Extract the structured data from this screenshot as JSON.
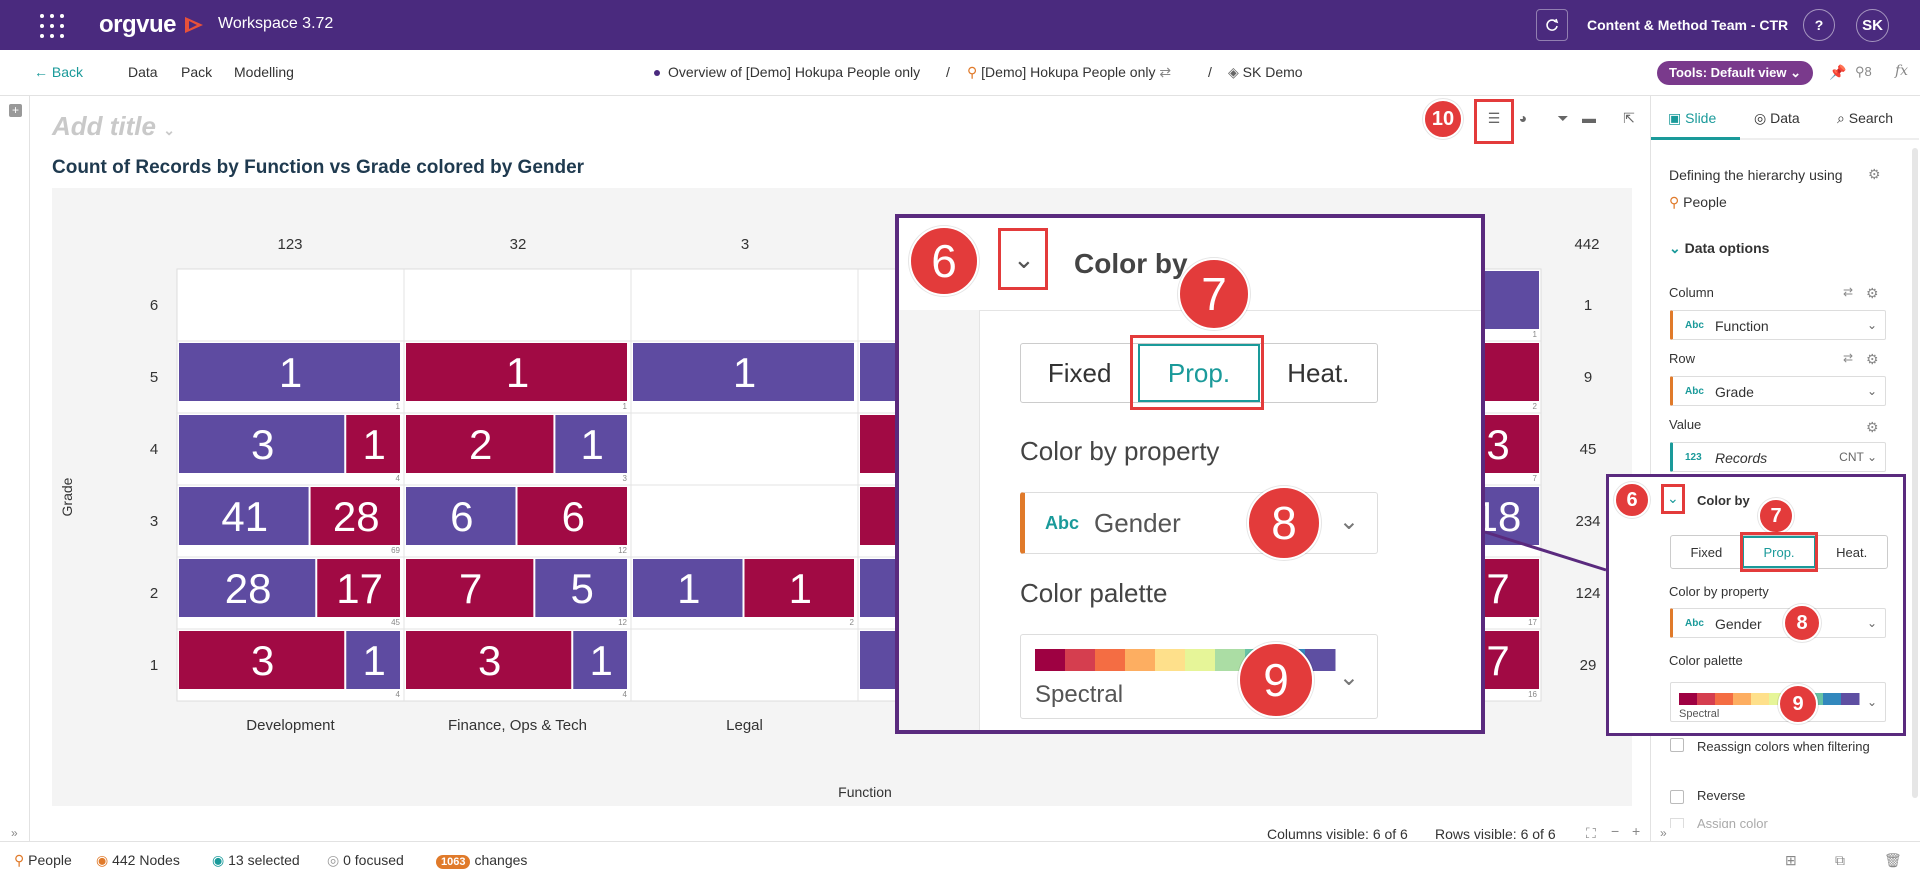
{
  "app": {
    "logo": "orgvue",
    "workspace": "Workspace  3.72",
    "team": "Content & Method Team - CTR",
    "help": "?",
    "avatar": "SK"
  },
  "subnav": {
    "back": "Back",
    "items": [
      "Data",
      "Pack",
      "Modelling"
    ],
    "crumb1": "Overview of [Demo] Hokupa People only",
    "crumb2": "[Demo] Hokupa People only",
    "crumb3": "SK Demo",
    "sep": "/",
    "tools": "Tools: Default view",
    "count": "8"
  },
  "canvas": {
    "add_title": "Add title",
    "chart_title": "Count of Records by Function vs Grade colored by Gender"
  },
  "chart_data": {
    "type": "heatmap",
    "title": "Count of Records by Function vs Grade colored by Gender",
    "xlabel": "Function",
    "ylabel": "Grade",
    "column_totals": [
      "123",
      "32",
      "3",
      "442"
    ],
    "row_labels": [
      "6",
      "5",
      "4",
      "3",
      "2",
      "1"
    ],
    "row_totals": [
      "1",
      "9",
      "45",
      "234",
      "124",
      "29"
    ],
    "column_labels": [
      "Development",
      "Finance, Ops & Tech",
      "Legal"
    ],
    "colors": {
      "purple": "#5e4ba1",
      "crimson": "#a10a44"
    },
    "cells": [
      {
        "col": 0,
        "row": 1,
        "parts": [
          {
            "v": "1",
            "c": "purple",
            "w": 1
          }
        ],
        "corner": "1"
      },
      {
        "col": 1,
        "row": 1,
        "parts": [
          {
            "v": "1",
            "c": "crimson",
            "w": 1
          }
        ],
        "corner": "1"
      },
      {
        "col": 2,
        "row": 1,
        "parts": [
          {
            "v": "1",
            "c": "purple",
            "w": 1
          }
        ],
        "corner": ""
      },
      {
        "col": 0,
        "row": 2,
        "parts": [
          {
            "v": "3",
            "c": "purple",
            "w": 0.75
          },
          {
            "v": "1",
            "c": "crimson",
            "w": 0.25
          }
        ],
        "corner": "4"
      },
      {
        "col": 1,
        "row": 2,
        "parts": [
          {
            "v": "2",
            "c": "crimson",
            "w": 0.67
          },
          {
            "v": "1",
            "c": "purple",
            "w": 0.33
          }
        ],
        "corner": "3"
      },
      {
        "col": 0,
        "row": 3,
        "parts": [
          {
            "v": "41",
            "c": "purple",
            "w": 0.59
          },
          {
            "v": "28",
            "c": "crimson",
            "w": 0.41
          }
        ],
        "corner": "69"
      },
      {
        "col": 1,
        "row": 3,
        "parts": [
          {
            "v": "6",
            "c": "purple",
            "w": 0.5
          },
          {
            "v": "6",
            "c": "crimson",
            "w": 0.5
          }
        ],
        "corner": "12"
      },
      {
        "col": 0,
        "row": 4,
        "parts": [
          {
            "v": "28",
            "c": "purple",
            "w": 0.62
          },
          {
            "v": "17",
            "c": "crimson",
            "w": 0.38
          }
        ],
        "corner": "45"
      },
      {
        "col": 1,
        "row": 4,
        "parts": [
          {
            "v": "7",
            "c": "crimson",
            "w": 0.58
          },
          {
            "v": "5",
            "c": "purple",
            "w": 0.42
          }
        ],
        "corner": "12"
      },
      {
        "col": 2,
        "row": 4,
        "parts": [
          {
            "v": "1",
            "c": "purple",
            "w": 0.5
          },
          {
            "v": "1",
            "c": "crimson",
            "w": 0.5
          }
        ],
        "corner": "2"
      },
      {
        "col": 0,
        "row": 5,
        "parts": [
          {
            "v": "3",
            "c": "crimson",
            "w": 0.75
          },
          {
            "v": "1",
            "c": "purple",
            "w": 0.25
          }
        ],
        "corner": "4"
      },
      {
        "col": 1,
        "row": 5,
        "parts": [
          {
            "v": "3",
            "c": "crimson",
            "w": 0.75
          },
          {
            "v": "1",
            "c": "purple",
            "w": 0.25
          }
        ],
        "corner": "4"
      }
    ],
    "partial_right_cells": [
      {
        "row": 0,
        "v": "",
        "c": "purple",
        "corner": "1"
      },
      {
        "row": 1,
        "v": "",
        "c": "crimson",
        "corner": "2"
      },
      {
        "row": 2,
        "v": "3",
        "c": "crimson",
        "corner": "7"
      },
      {
        "row": 3,
        "v": "18",
        "c": "purple",
        "corner": ""
      },
      {
        "row": 4,
        "v": "7",
        "c": "crimson",
        "corner": "17"
      },
      {
        "row": 5,
        "v": "7",
        "c": "crimson",
        "corner": "16"
      }
    ],
    "partial_left_cells": [
      1,
      2,
      3,
      4,
      5
    ]
  },
  "toolbar": {
    "badge": "10"
  },
  "panel": {
    "tabs": [
      "Slide",
      "Data",
      "Search"
    ],
    "hierarchy_text": "Defining the hierarchy using",
    "hierarchy_value": "People",
    "data_options": "Data options",
    "column_label": "Column",
    "column_value": "Function",
    "row_label": "Row",
    "row_value": "Grade",
    "value_label": "Value",
    "value_value": "Records",
    "value_agg": "CNT",
    "abc": "Abc",
    "num": "123",
    "color_by": "Color by",
    "color_modes": [
      "Fixed",
      "Prop.",
      "Heat."
    ],
    "color_by_property": "Color by property",
    "property_value": "Gender",
    "color_palette": "Color palette",
    "palette_value": "Spectral",
    "reassign": "Reassign colors when filtering",
    "reverse": "Reverse",
    "assign": "Assign color"
  },
  "palette_colors": [
    "#9e0142",
    "#d53e4f",
    "#f46d43",
    "#fdae61",
    "#fee08b",
    "#e6f598",
    "#abdda4",
    "#66c2a5",
    "#3288bd",
    "#5e4fa2"
  ],
  "footer": {
    "columns_visible": "Columns visible: 6 of 6",
    "rows_visible": "Rows visible: 6 of 6",
    "people": "People",
    "nodes": "442 Nodes",
    "selected": "13 selected",
    "focused": "0 focused",
    "changes_count": "1063",
    "changes": "changes"
  },
  "callouts": [
    "6",
    "7",
    "8",
    "9",
    "10"
  ]
}
